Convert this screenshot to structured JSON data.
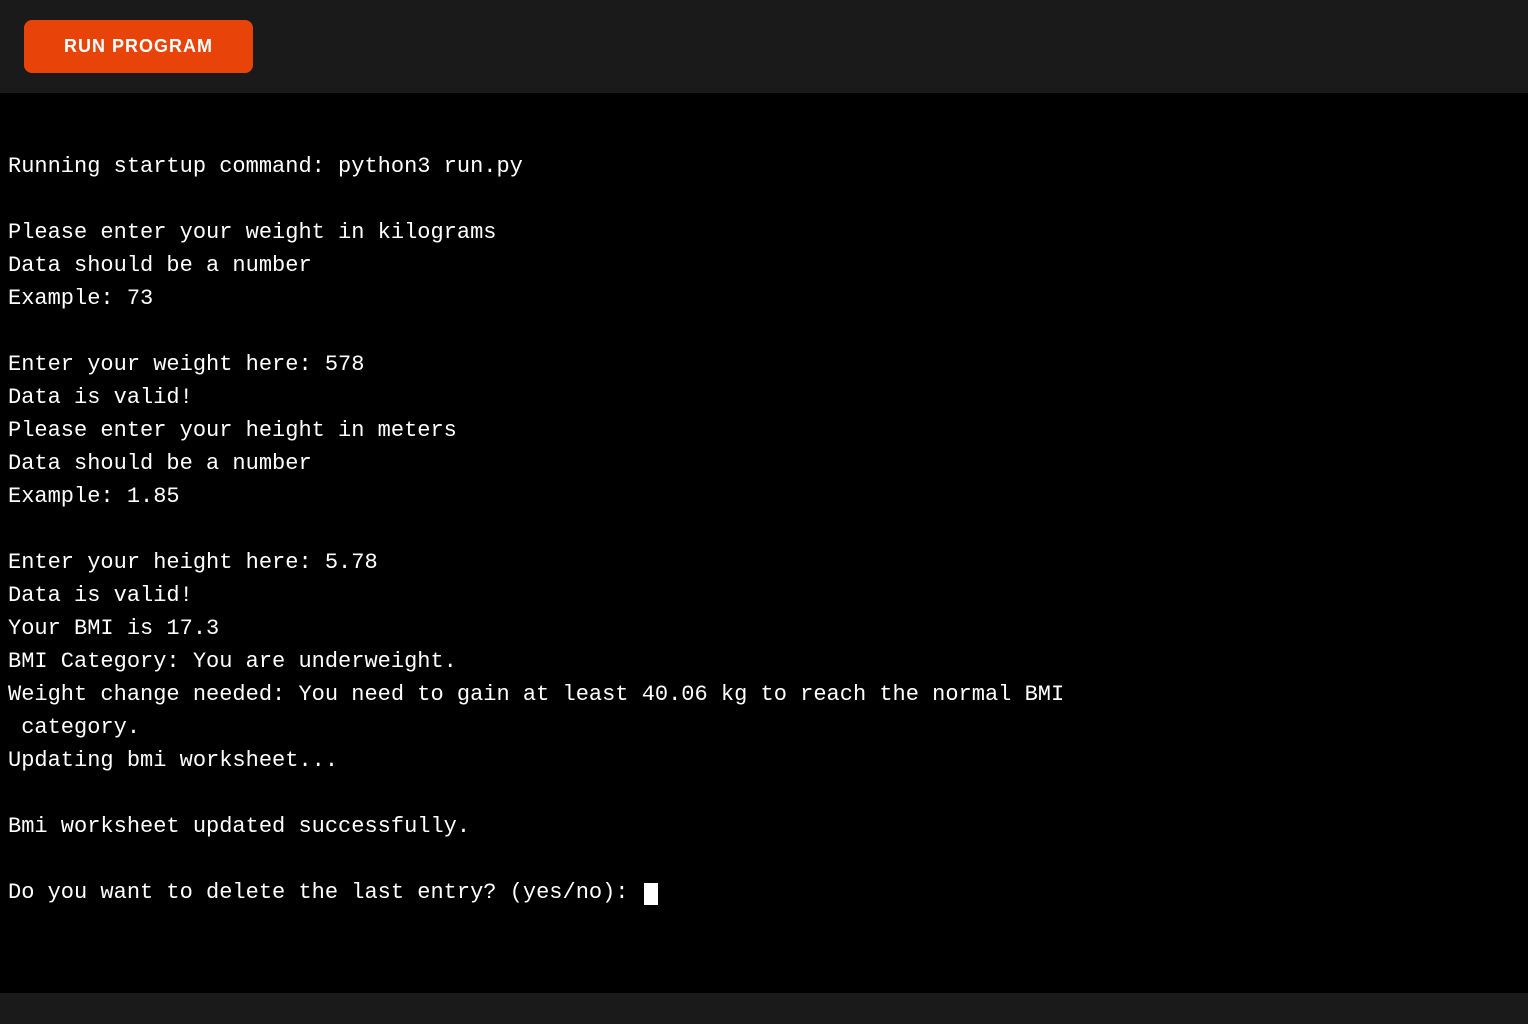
{
  "toolbar": {
    "run_button_label": "RUN PROGRAM"
  },
  "terminal": {
    "lines": [
      "Running startup command: python3 run.py",
      "",
      "Please enter your weight in kilograms",
      "Data should be a number",
      "Example: 73",
      "",
      "Enter your weight here: 578",
      "Data is valid!",
      "Please enter your height in meters",
      "Data should be a number",
      "Example: 1.85",
      "",
      "Enter your height here: 5.78",
      "Data is valid!",
      "Your BMI is 17.3",
      "BMI Category: You are underweight.",
      "Weight change needed: You need to gain at least 40.06 kg to reach the normal BMI",
      " category.",
      "Updating bmi worksheet...",
      "",
      "Bmi worksheet updated successfully.",
      "",
      "Do you want to delete the last entry? (yes/no): "
    ]
  }
}
